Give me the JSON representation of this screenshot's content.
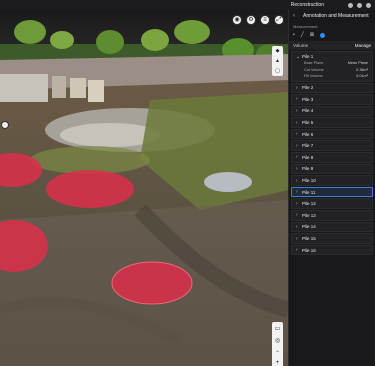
{
  "topbar": {
    "title": "Reconstruction",
    "icons": [
      "bell-icon",
      "gear-icon",
      "user-icon"
    ]
  },
  "view_tools": [
    "camera-icon",
    "settings-icon",
    "layers-icon",
    "fullscreen-icon"
  ],
  "nav_stack": [
    "compass-icon",
    "north-icon",
    "perspective-icon"
  ],
  "zoom_stack": [
    "ruler-icon",
    "measure-icon",
    "zoom-out-icon",
    "zoom-in-icon"
  ],
  "panel": {
    "title": "Annotation and Measurement",
    "measurement_label": "Measurement",
    "tools": [
      "point-tool-icon",
      "line-tool-icon",
      "area-tool-icon",
      "volume-tool-icon"
    ],
    "volume_label": "Volume",
    "manage_label": "Manage",
    "open_pile": {
      "name": "Pile 1",
      "details": [
        {
          "label": "Base Plane",
          "value": "Mean Plane"
        },
        {
          "label": "Cut Volume",
          "value": "0.36m³"
        },
        {
          "label": "Fill Volume",
          "value": "0.01m³"
        }
      ]
    },
    "piles": [
      "Pile 2",
      "Pile 3",
      "Pile 4",
      "Pile 5",
      "Pile 6",
      "Pile 7",
      "Pile 8",
      "Pile 9",
      "Pile 10",
      "Pile 11",
      "Pile 12",
      "Pile 13",
      "Pile 14",
      "Pile 15",
      "Pile 16"
    ],
    "selected_pile": "Pile 11"
  },
  "colors": {
    "pile_highlight": "#d8304a",
    "accent": "#2d8cff",
    "panel_bg": "#19191b"
  }
}
